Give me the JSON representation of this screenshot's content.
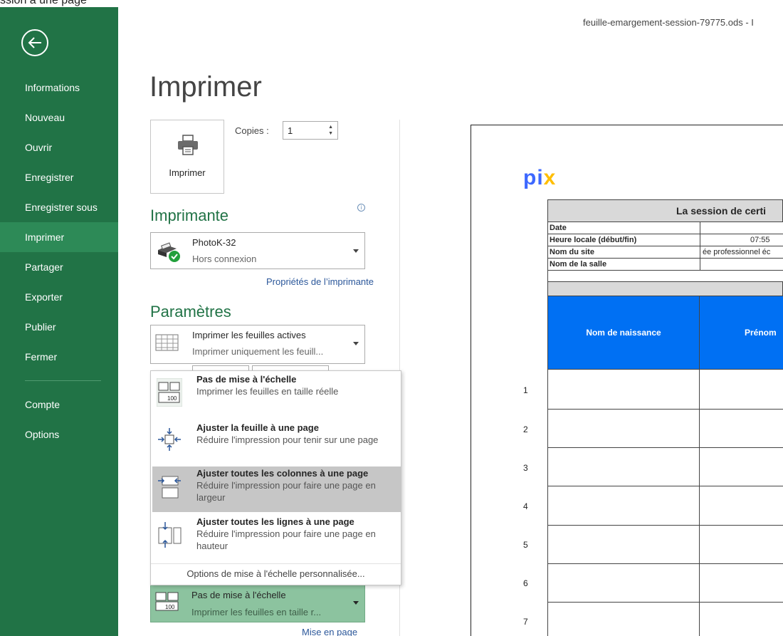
{
  "top_clipped_text": "ssion à une page",
  "window": {
    "filename": "feuille-emargement-session-79775.ods - I"
  },
  "sidebar": {
    "back_icon": "back-arrow-icon",
    "items": [
      {
        "label": "Informations"
      },
      {
        "label": "Nouveau"
      },
      {
        "label": "Ouvrir"
      },
      {
        "label": "Enregistrer"
      },
      {
        "label": "Enregistrer sous"
      },
      {
        "label": "Imprimer"
      },
      {
        "label": "Partager"
      },
      {
        "label": "Exporter"
      },
      {
        "label": "Publier"
      },
      {
        "label": "Fermer"
      }
    ],
    "bottom_items": [
      {
        "label": "Compte"
      },
      {
        "label": "Options"
      }
    ],
    "active": "Imprimer",
    "accent": "#217346"
  },
  "main": {
    "title": "Imprimer",
    "print_button": {
      "label": "Imprimer",
      "icon": "printer-icon"
    },
    "copies": {
      "label": "Copies :",
      "value": "1"
    },
    "printer_section": {
      "heading": "Imprimante",
      "name": "PhotoK-32",
      "status": "Hors connexion",
      "properties_link": "Propriétés de l’imprimante"
    },
    "settings_section": {
      "heading": "Paramètres",
      "sheets": {
        "title": "Imprimer les feuilles actives",
        "desc": "Imprimer uniquement les feuill..."
      }
    },
    "scaling_menu": {
      "items": [
        {
          "title": "Pas de mise à l'échelle",
          "desc": "Imprimer les feuilles en taille réelle",
          "icon": "no-scaling-icon"
        },
        {
          "title": "Ajuster la feuille à une page",
          "desc": "Réduire l'impression pour tenir sur une page",
          "icon": "fit-sheet-icon"
        },
        {
          "title": "Ajuster toutes les colonnes à une page",
          "desc": "Réduire l'impression pour faire une page en largeur",
          "icon": "fit-columns-icon"
        },
        {
          "title": "Ajuster toutes les lignes à une page",
          "desc": "Réduire l'impression pour faire une page en hauteur",
          "icon": "fit-rows-icon"
        }
      ],
      "custom_options": "Options de mise à l'échelle personnalisée..."
    },
    "scaling_select": {
      "title": "Pas de mise à l'échelle",
      "desc": "Imprimer les feuilles en taille r..."
    },
    "page_setup_link": "Mise en page"
  },
  "preview": {
    "logo": {
      "p": "p",
      "i": "i",
      "x": "x"
    },
    "sheet_title": "La session de certi",
    "info_rows": [
      {
        "label": "Date",
        "value": ""
      },
      {
        "label": "Heure locale (début/fin)",
        "value": "07:55"
      },
      {
        "label": "Nom du site",
        "value": "ée professionnel éc"
      },
      {
        "label": "Nom de la salle",
        "value": ""
      }
    ],
    "columns": [
      "Nom de naissance",
      "Prénom"
    ],
    "row_numbers": [
      "1",
      "2",
      "3",
      "4",
      "5",
      "6",
      "7"
    ]
  }
}
